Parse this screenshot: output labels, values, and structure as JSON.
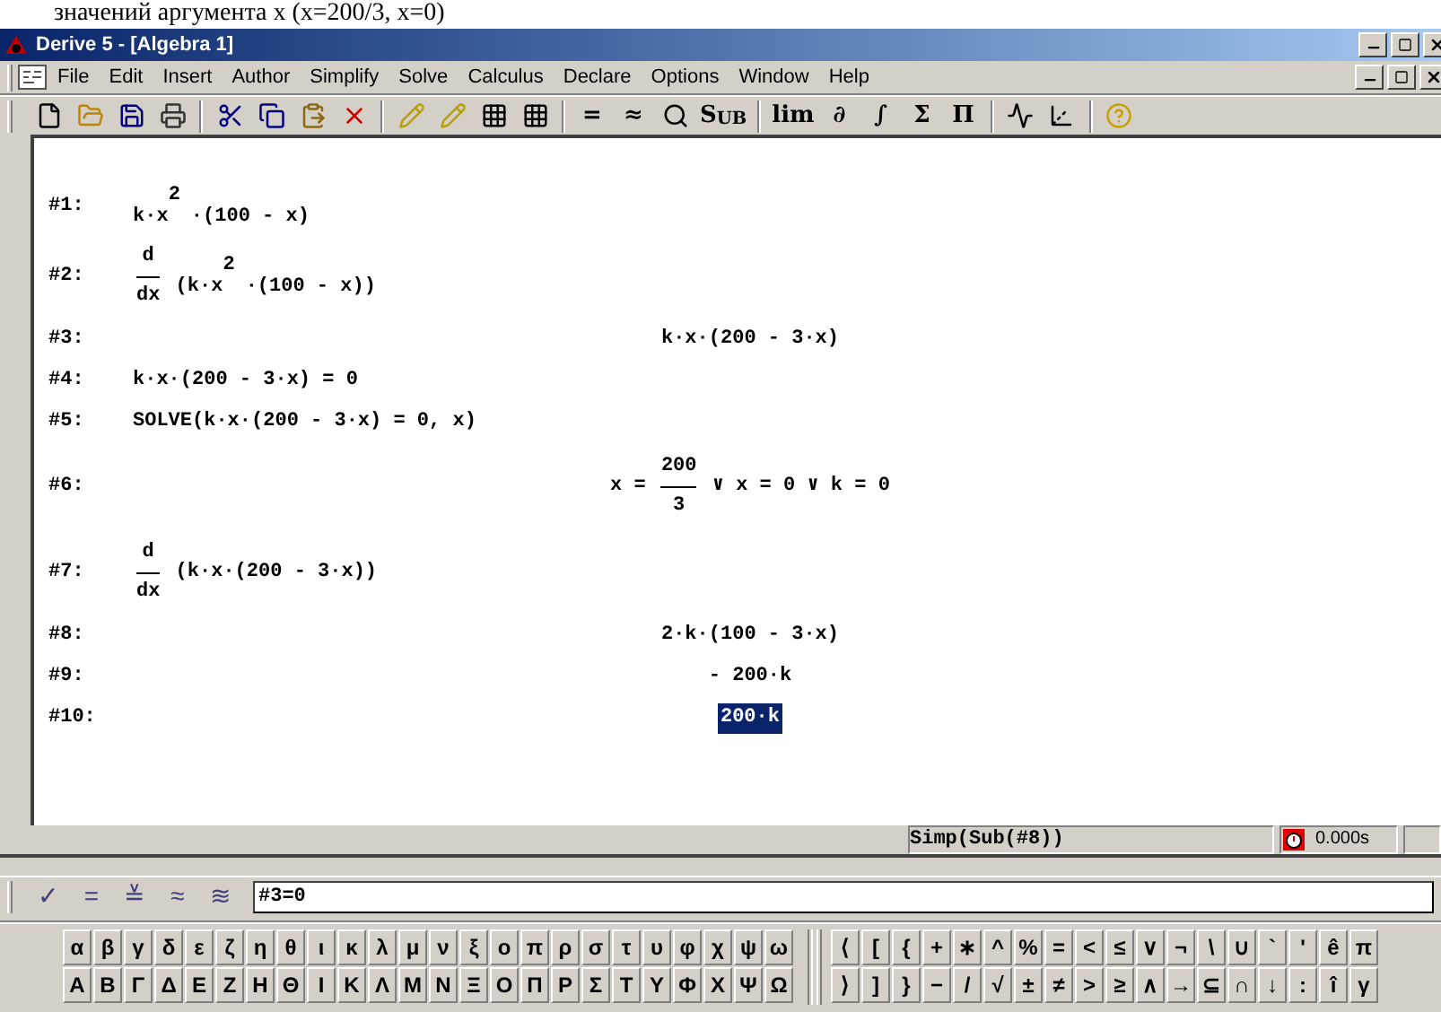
{
  "caption": "значений аргумента x (x=200/3, x=0)",
  "window": {
    "title": "Derive 5 - [Algebra 1]"
  },
  "menu": [
    "File",
    "Edit",
    "Insert",
    "Author",
    "Simplify",
    "Solve",
    "Calculus",
    "Declare",
    "Options",
    "Window",
    "Help"
  ],
  "toolbar": [
    {
      "kind": "icon"
    },
    {
      "kind": "icon"
    },
    {
      "kind": "icon"
    },
    {
      "kind": "icon"
    },
    {
      "kind": "sep"
    },
    {
      "kind": "icon"
    },
    {
      "kind": "icon"
    },
    {
      "kind": "icon"
    },
    {
      "kind": "icon"
    },
    {
      "kind": "sep"
    },
    {
      "kind": "icon"
    },
    {
      "kind": "icon"
    },
    {
      "kind": "icon"
    },
    {
      "kind": "icon"
    },
    {
      "kind": "sep"
    },
    {
      "kind": "text",
      "label": "="
    },
    {
      "kind": "text",
      "label": "≈"
    },
    {
      "kind": "icon"
    },
    {
      "kind": "text",
      "label": "S$_{UB}$"
    },
    {
      "kind": "sep"
    },
    {
      "kind": "text",
      "label": "lim"
    },
    {
      "kind": "text",
      "label": "∂"
    },
    {
      "kind": "text",
      "label": "∫"
    },
    {
      "kind": "text",
      "label": "Σ"
    },
    {
      "kind": "text",
      "label": "Π"
    },
    {
      "kind": "sep"
    },
    {
      "kind": "icon"
    },
    {
      "kind": "icon"
    },
    {
      "kind": "sep"
    },
    {
      "kind": "icon"
    }
  ],
  "expressions": [
    {
      "label": "#1:",
      "kind": "input",
      "selected": false,
      "segments": [
        {
          "kind": "text",
          "text": "k·x$^{2}$·(100 - x)"
        }
      ]
    },
    {
      "label": "#2:",
      "kind": "input",
      "selected": false,
      "segments": [
        {
          "kind": "frac",
          "num": "d",
          "den": "dx"
        },
        {
          "kind": "text",
          "text": " (k·x$^{2}$·(100 - x))"
        }
      ]
    },
    {
      "label": "#3:",
      "kind": "result",
      "selected": false,
      "segments": [
        {
          "kind": "text",
          "text": "k·x·(200 - 3·x)"
        }
      ]
    },
    {
      "label": "#4:",
      "kind": "input",
      "selected": false,
      "segments": [
        {
          "kind": "text",
          "text": "k·x·(200 - 3·x) = 0"
        }
      ]
    },
    {
      "label": "#5:",
      "kind": "input",
      "selected": false,
      "segments": [
        {
          "kind": "text",
          "text": "SOLVE(k·x·(200 - 3·x) = 0, x)"
        }
      ]
    },
    {
      "label": "#6:",
      "kind": "result",
      "selected": false,
      "segments": [
        {
          "kind": "text",
          "text": "x = "
        },
        {
          "kind": "frac",
          "num": "200",
          "den": "3"
        },
        {
          "kind": "text",
          "text": " ∨ x = 0 ∨ k = 0"
        }
      ]
    },
    {
      "label": "#7:",
      "kind": "input",
      "selected": false,
      "segments": [
        {
          "kind": "frac",
          "num": "d",
          "den": "dx"
        },
        {
          "kind": "text",
          "text": " (k·x·(200 - 3·x))"
        }
      ]
    },
    {
      "label": "#8:",
      "kind": "result",
      "selected": false,
      "segments": [
        {
          "kind": "text",
          "text": "2·k·(100 - 3·x)"
        }
      ]
    },
    {
      "label": "#9:",
      "kind": "result",
      "selected": false,
      "segments": [
        {
          "kind": "text",
          "text": "- 200·k"
        }
      ]
    },
    {
      "label": "#10:",
      "kind": "result",
      "selected": true,
      "segments": [
        {
          "kind": "text",
          "text": "200·k"
        }
      ]
    }
  ],
  "status_bar": {
    "command": "Simp(Sub(#8))",
    "time": "0.000s"
  },
  "author_bar": {
    "buttons": [
      "✓",
      "=",
      "≚",
      "≈",
      "≋"
    ],
    "value": "#3=0"
  },
  "greek_lower": [
    "α",
    "β",
    "γ",
    "δ",
    "ε",
    "ζ",
    "η",
    "θ",
    "ι",
    "κ",
    "λ",
    "μ",
    "ν",
    "ξ",
    "ο",
    "π",
    "ρ",
    "σ",
    "τ",
    "υ",
    "φ",
    "χ",
    "ψ",
    "ω"
  ],
  "greek_upper": [
    "Α",
    "Β",
    "Γ",
    "Δ",
    "Ε",
    "Ζ",
    "Η",
    "Θ",
    "Ι",
    "Κ",
    "Λ",
    "Μ",
    "Ν",
    "Ξ",
    "Ο",
    "Π",
    "Ρ",
    "Σ",
    "Τ",
    "Υ",
    "Φ",
    "Χ",
    "Ψ",
    "Ω"
  ],
  "symbols_top": [
    "⟨",
    "[",
    "{",
    "+",
    "∗",
    "^",
    "%",
    "=",
    "<",
    "≤",
    "∨",
    "¬",
    "\\",
    "∪",
    "`",
    "'",
    "ê",
    "π"
  ],
  "symbols_bottom": [
    "⟩",
    "]",
    "}",
    "−",
    "/",
    "√",
    "±",
    "≠",
    ">",
    "≥",
    "∧",
    "→",
    "⊆",
    "∩",
    "↓",
    ":",
    "î",
    "γ"
  ]
}
